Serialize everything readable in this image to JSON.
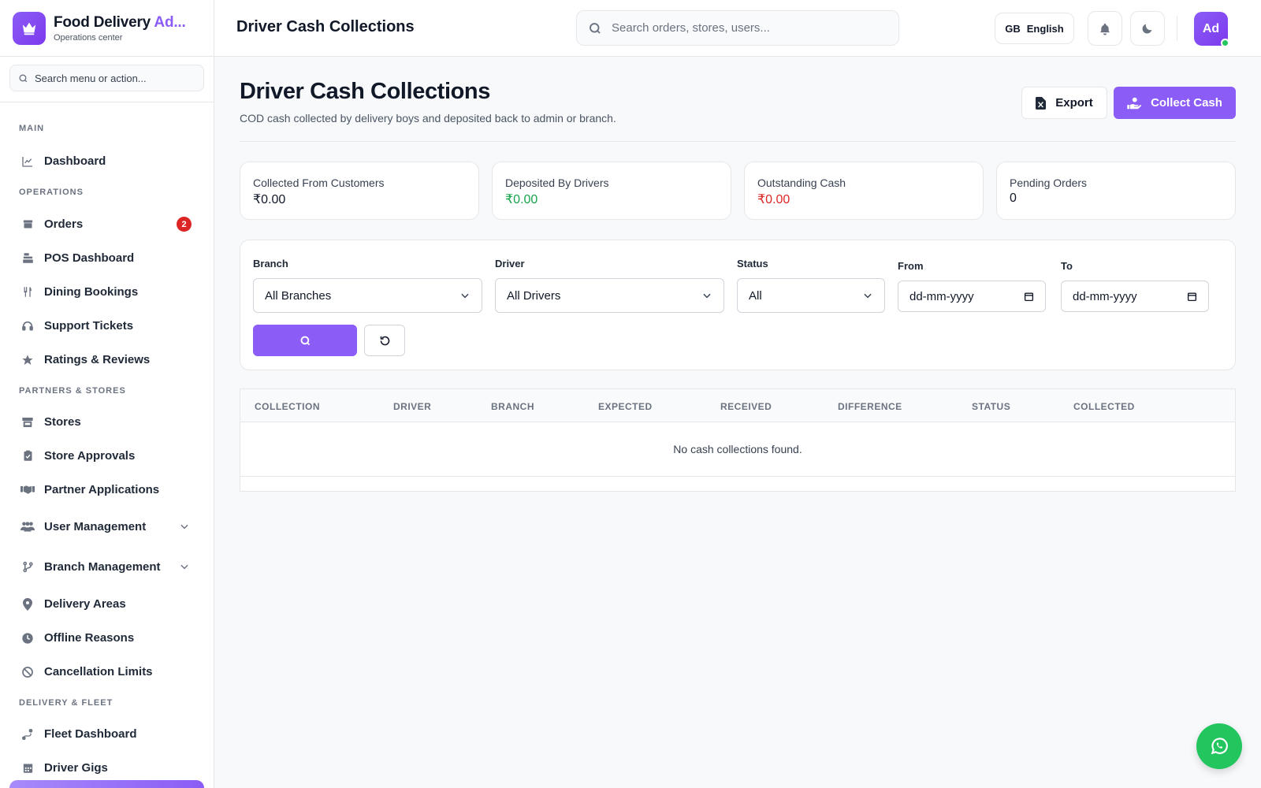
{
  "brand": {
    "title_main": "Food Delivery ",
    "title_accent": "Ad...",
    "subtitle": "Operations center"
  },
  "sidebar": {
    "search_placeholder": "Search menu or action...",
    "sections": {
      "main": "MAIN",
      "operations": "OPERATIONS",
      "partners": "PARTNERS & STORES",
      "delivery": "DELIVERY & FLEET"
    },
    "items": {
      "dashboard": "Dashboard",
      "orders": "Orders",
      "orders_badge": "2",
      "pos": "POS Dashboard",
      "dining": "Dining Bookings",
      "support": "Support Tickets",
      "ratings": "Ratings & Reviews",
      "stores": "Stores",
      "store_approvals": "Store Approvals",
      "partner_apps": "Partner Applications",
      "user_mgmt": "User Management",
      "branch_mgmt": "Branch Management",
      "delivery_areas": "Delivery Areas",
      "offline_reasons": "Offline Reasons",
      "cancellation_limits": "Cancellation Limits",
      "fleet_dashboard": "Fleet Dashboard",
      "driver_gigs": "Driver Gigs"
    }
  },
  "topbar": {
    "title": "Driver Cash Collections",
    "search_placeholder": "Search orders, stores, users...",
    "lang_code": "GB",
    "lang_label": "English",
    "avatar_initials": "Ad"
  },
  "page": {
    "title": "Driver Cash Collections",
    "description": "COD cash collected by delivery boys and deposited back to admin or branch.",
    "export_label": "Export",
    "collect_label": "Collect Cash"
  },
  "stats": [
    {
      "label": "Collected From Customers",
      "value": "₹0.00"
    },
    {
      "label": "Deposited By Drivers",
      "value": "₹0.00"
    },
    {
      "label": "Outstanding Cash",
      "value": "₹0.00"
    },
    {
      "label": "Pending Orders",
      "value": "0"
    }
  ],
  "filters": {
    "branch_label": "Branch",
    "branch_value": "All Branches",
    "driver_label": "Driver",
    "driver_value": "All Drivers",
    "status_label": "Status",
    "status_value": "All",
    "from_label": "From",
    "from_value": "dd-mm-yyyy",
    "to_label": "To",
    "to_value": "dd-mm-yyyy"
  },
  "table": {
    "columns": [
      "COLLECTION",
      "DRIVER",
      "BRANCH",
      "EXPECTED",
      "RECEIVED",
      "DIFFERENCE",
      "STATUS",
      "COLLECTED"
    ],
    "empty_text": "No cash collections found."
  },
  "colors": {
    "accent": "#8b5cf6",
    "positive": "#16a34a",
    "negative": "#dc2626",
    "whatsapp": "#22c55e"
  }
}
